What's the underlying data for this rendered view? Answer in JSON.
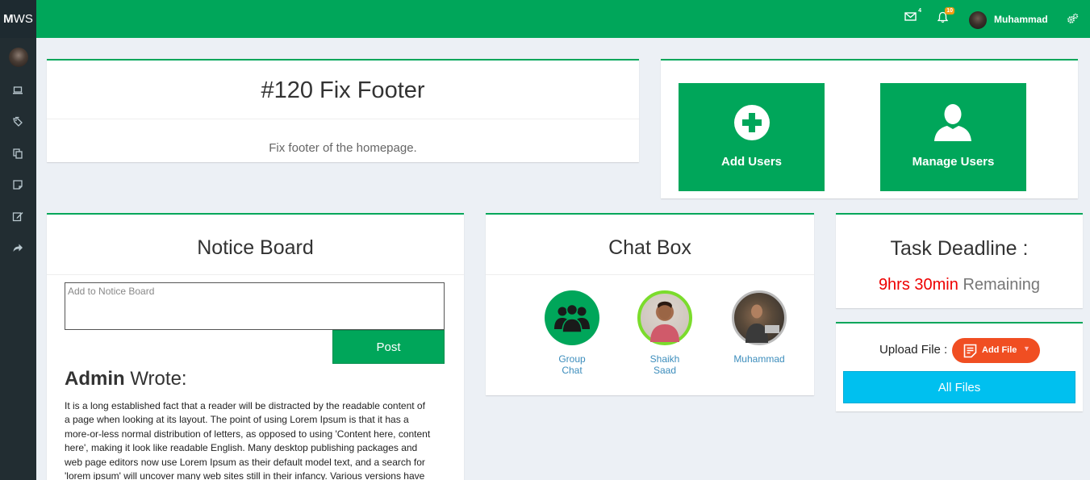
{
  "logo": {
    "bold": "M",
    "rest": "WS"
  },
  "header": {
    "mail_badge": "4",
    "notif_badge": "10",
    "user_name": "Muhammad"
  },
  "sidebar": {
    "icons": [
      "laptop-icon",
      "tags-icon",
      "copy-icon",
      "sticky-note-icon",
      "edit-icon",
      "share-icon"
    ]
  },
  "task": {
    "title": "#120 Fix Footer",
    "description": "Fix footer of the homepage."
  },
  "user_tiles": [
    {
      "label": "Add Users",
      "icon": "plus-circle-icon"
    },
    {
      "label": "Manage Users",
      "icon": "user-icon"
    }
  ],
  "notice_board": {
    "title": "Notice Board",
    "placeholder": "Add to Notice Board",
    "post_label": "Post",
    "author": "Admin",
    "wrote_suffix": " Wrote:",
    "text": "It is a long established fact that a reader will be distracted by the readable content of a page when looking at its layout. The point of using Lorem Ipsum is that it has a more-or-less normal distribution of letters, as opposed to using 'Content here, content here', making it look like readable English. Many desktop publishing packages and web page editors now use Lorem Ipsum as their default model text, and a search for 'lorem ipsum' will uncover many web sites still in their infancy. Various versions have evolved over the years, sometimes by accident, sometimes on purpose."
  },
  "chat_box": {
    "title": "Chat Box",
    "contacts": [
      {
        "line1": "Group",
        "line2": "Chat"
      },
      {
        "line1": "Shaikh",
        "line2": "Saad"
      },
      {
        "line1": "Muhammad",
        "line2": ""
      }
    ]
  },
  "deadline": {
    "title": "Task Deadline :",
    "remaining_value": "9hrs 30min",
    "remaining_label": "Remaining"
  },
  "upload": {
    "label": "Upload File :",
    "add_file": "Add File",
    "all_files": "All Files"
  },
  "colors": {
    "primary": "#00a65a",
    "sidebar": "#222d32",
    "info": "#00c0ef",
    "danger_red": "#ee0000",
    "add_file": "#f04e22"
  }
}
